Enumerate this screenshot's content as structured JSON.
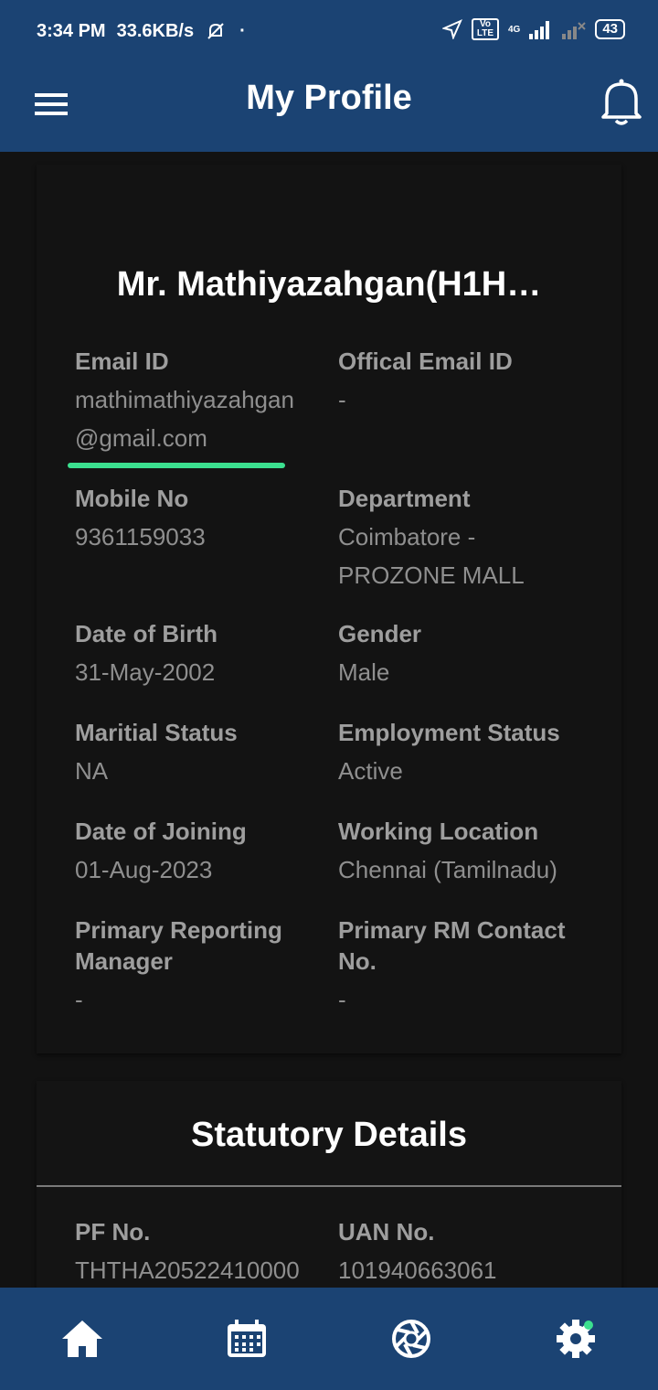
{
  "status_bar": {
    "time": "3:34 PM",
    "speed": "33.6KB/s",
    "battery": "43",
    "network": "4G",
    "volte": "Vo LTE",
    "icons": [
      "muted-bell-icon",
      "location-arrow-icon",
      "volte-icon",
      "signal-icon",
      "signal-x-icon",
      "battery-icon"
    ]
  },
  "app_bar": {
    "title": "My Profile",
    "left_icon": "menu-icon",
    "right_icon": "bell-icon"
  },
  "profile": {
    "name": "Mr. Mathiyazahgan(H1H…",
    "fields": {
      "email": {
        "label": "Email ID",
        "value": "mathimathiyazahgan\n@gmail.com"
      },
      "official_email": {
        "label": "Offical Email ID",
        "value": "-"
      },
      "mobile": {
        "label": "Mobile No",
        "value": "9361159033"
      },
      "department": {
        "label": "Department",
        "value": "Coimbatore - PROZONE MALL"
      },
      "dob": {
        "label": "Date of Birth",
        "value": "31-May-2002"
      },
      "gender": {
        "label": "Gender",
        "value": "Male"
      },
      "marital": {
        "label": "Maritial Status",
        "value": "NA"
      },
      "employment": {
        "label": "Employment Status",
        "value": "Active"
      },
      "joining": {
        "label": "Date of Joining",
        "value": "01-Aug-2023"
      },
      "location": {
        "label": "Working Location",
        "value": "Chennai (Tamilnadu)"
      },
      "reporting_manager": {
        "label": "Primary Reporting Manager",
        "value": "-"
      },
      "rm_contact": {
        "label": "Primary RM Contact No.",
        "value": "-"
      }
    }
  },
  "statutory": {
    "title": "Statutory Details",
    "pf": {
      "label": "PF No.",
      "value": "THTHA20522410000"
    },
    "uan": {
      "label": "UAN No.",
      "value": "101940663061"
    }
  },
  "bottom_nav": {
    "items": [
      "home-icon",
      "calendar-icon",
      "aperture-icon",
      "settings-icon"
    ]
  },
  "colors": {
    "primary": "#1b4373",
    "background": "#121212",
    "highlight": "#3be08f",
    "label": "#9e9e9e",
    "value": "#8f8f8f"
  }
}
